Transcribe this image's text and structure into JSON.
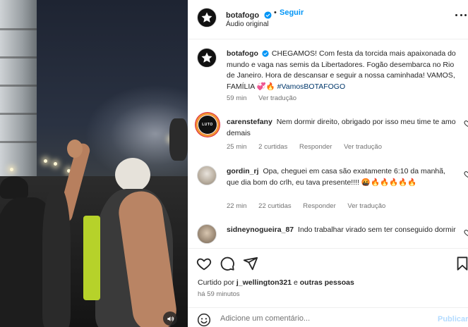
{
  "post": {
    "author": "botafogo",
    "follow_label": "Seguir",
    "separator": "•",
    "audio_label": "Áudio original"
  },
  "caption": {
    "username": "botafogo",
    "text": "CHEGAMOS! Com festa da torcida mais apaixonada do mundo e vaga nas semis da Libertadores. Fogão desembarca no Rio de Janeiro. Hora de descansar e seguir a nossa caminhada! VAMOS, FAMÍLIA 💞🔥",
    "hashtag": "#VamosBOTAFOGO",
    "time": "59 min",
    "translate": "Ver tradução"
  },
  "comments": [
    {
      "username": "carenstefany",
      "text": "Nem dormir direito, obrigado por isso meu time te amo demais",
      "time": "25 min",
      "likes": "2 curtidas",
      "reply": "Responder",
      "translate": "Ver tradução",
      "avatar_text": "LUTO"
    },
    {
      "username": "gordin_rj",
      "text": "Opa, cheguei em casa são exatamente 6:10 da manhã, que dia bom do crlh, eu tava presente!!!! 🤬🔥🔥🔥🔥🔥",
      "time": "22 min",
      "likes": "22 curtidas",
      "reply": "Responder",
      "translate": "Ver tradução"
    },
    {
      "username": "sidneynogueira_87",
      "text": "Indo trabalhar virado sem ter conseguido dormir"
    }
  ],
  "footer": {
    "liked_prefix": "Curtido por",
    "liked_user": "j_wellington321",
    "liked_mid": "e",
    "liked_others": "outras pessoas",
    "time_ago": "há 59 minutos",
    "comment_placeholder": "Adicione um comentário...",
    "publish_label": "Publicar"
  },
  "icons": {
    "like": "heart-icon",
    "comment": "comment-icon",
    "share": "paper-plane-icon",
    "save": "bookmark-icon",
    "emoji": "smiley-icon",
    "sound": "speaker-icon",
    "more": "more-options-icon",
    "verified": "verified-badge-icon"
  },
  "colors": {
    "accent": "#0095f6",
    "verified": "#0095f6",
    "secondary_text": "#737373",
    "hashtag": "#00376b",
    "divider": "#efefef",
    "publish_disabled": "#b3dbff"
  }
}
